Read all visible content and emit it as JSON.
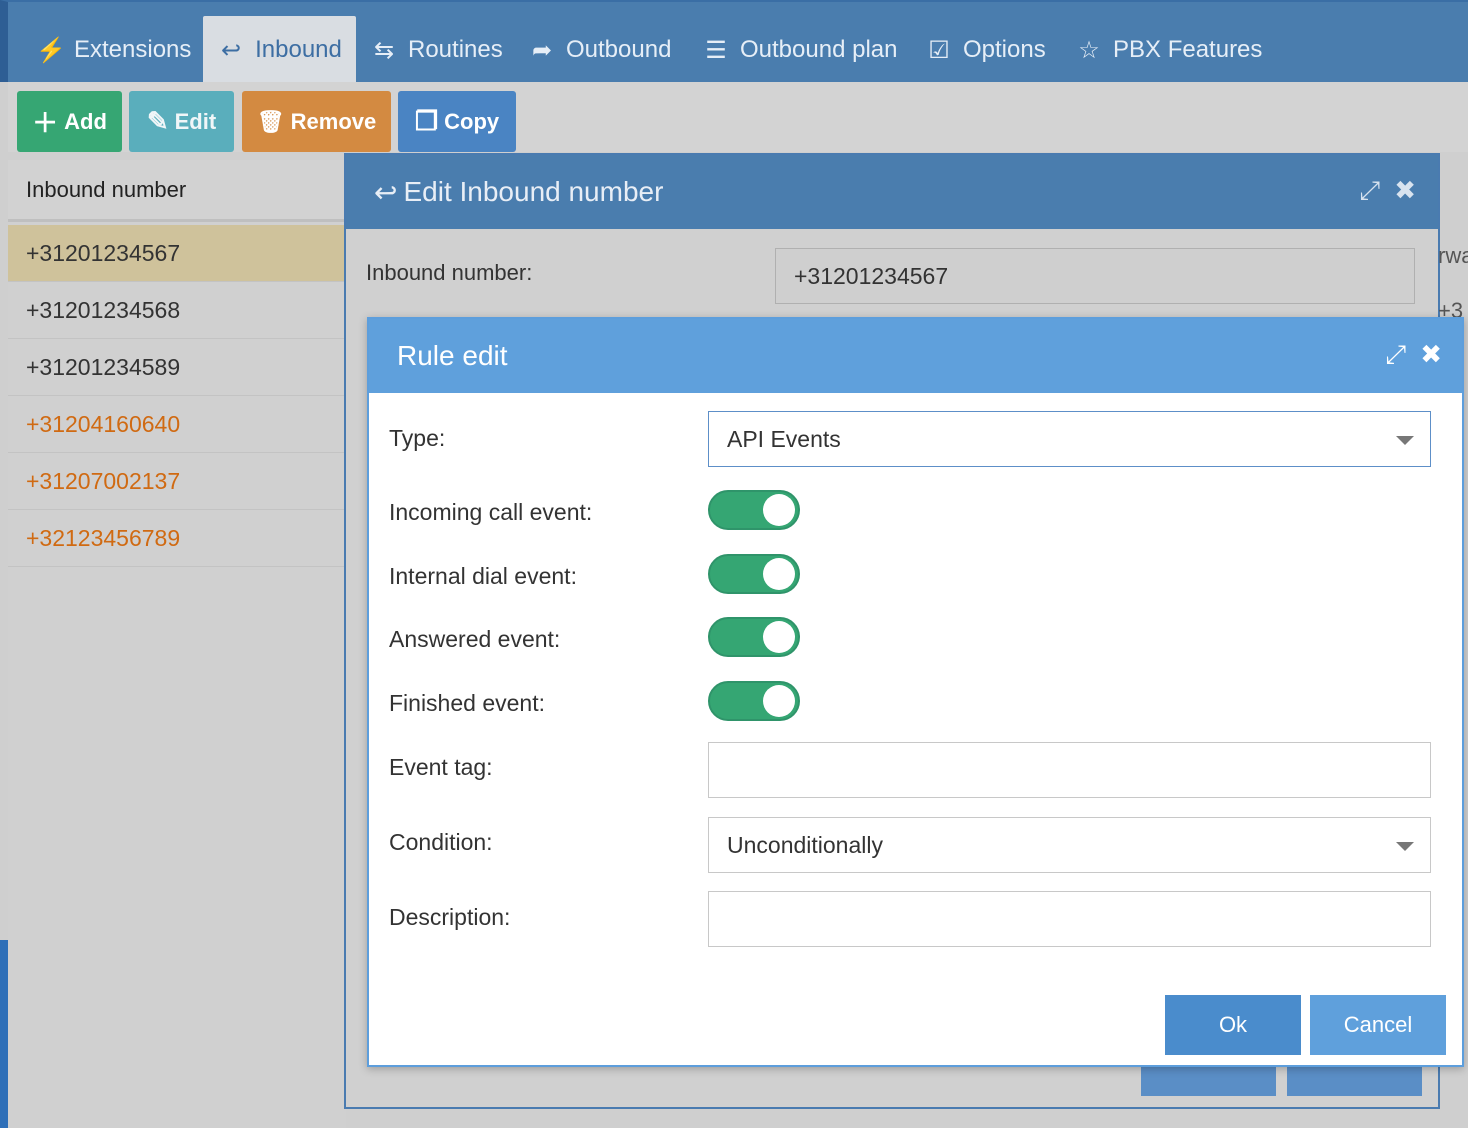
{
  "nav": {
    "tabs": [
      {
        "label": "Extensions",
        "icon": "⚡"
      },
      {
        "label": "Inbound",
        "icon": "↩"
      },
      {
        "label": "Routines",
        "icon": "⇆"
      },
      {
        "label": "Outbound",
        "icon": "➦"
      },
      {
        "label": "Outbound plan",
        "icon": "☰"
      },
      {
        "label": "Options",
        "icon": "☑"
      },
      {
        "label": "PBX Features",
        "icon": "☆"
      }
    ],
    "active": "Inbound"
  },
  "toolbar": {
    "add": "Add",
    "edit": "Edit",
    "remove": "Remove",
    "copy": "Copy",
    "icons": {
      "add": "＋",
      "edit": "✎",
      "remove": "🗑",
      "copy": "❐"
    }
  },
  "list": {
    "header": "Inbound number",
    "rows": [
      {
        "number": "+31201234567"
      },
      {
        "number": "+31201234568"
      },
      {
        "number": "+31201234589"
      },
      {
        "number": "+31204160640"
      },
      {
        "number": "+31207002137"
      },
      {
        "number": "+32123456789"
      }
    ]
  },
  "edit_dialog": {
    "title": "Edit Inbound number",
    "number_label": "Inbound number:",
    "number_value": "+31201234567",
    "peek_right_1": "rwa",
    "peek_right_2": "+3"
  },
  "rule_dialog": {
    "title": "Rule edit",
    "type_label": "Type:",
    "type_value": "API Events",
    "incoming_label": "Incoming call event:",
    "internal_label": "Internal dial event:",
    "answered_label": "Answered event:",
    "finished_label": "Finished event:",
    "event_tag_label": "Event tag:",
    "event_tag_value": "",
    "condition_label": "Condition:",
    "condition_value": "Unconditionally",
    "description_label": "Description:",
    "description_value": "",
    "ok": "Ok",
    "cancel": "Cancel",
    "toggles": {
      "incoming": true,
      "internal": true,
      "answered": true,
      "finished": true
    }
  },
  "colors": {
    "nav": "#4a7dae",
    "rule_header": "#5fa0dc",
    "toggle_on": "#35a673",
    "orange_text": "#d06a12",
    "selected_row": "#cfc29b"
  }
}
